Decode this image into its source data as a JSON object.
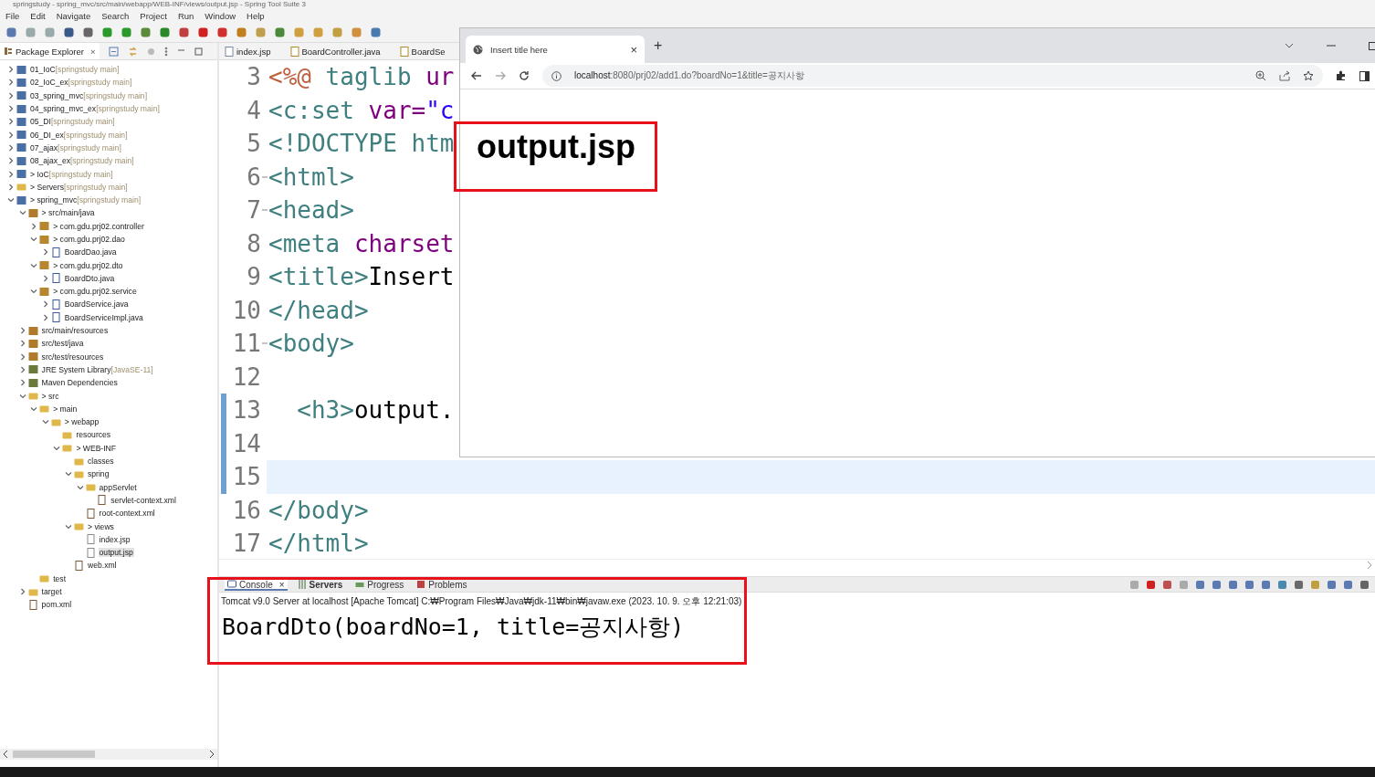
{
  "window": {
    "title": "springstudy - spring_mvc/src/main/webapp/WEB-INF/views/output.jsp - Spring Tool Suite 3"
  },
  "menu": [
    "File",
    "Edit",
    "Navigate",
    "Search",
    "Project",
    "Run",
    "Window",
    "Help"
  ],
  "explorer": {
    "title": "Package Explorer",
    "close": "×",
    "tree": [
      {
        "label": "01_IoC",
        "note": "[springstudy main]",
        "kind": "project",
        "expanded": false,
        "selected": false
      },
      {
        "label": "02_IoC_ex",
        "note": "[springstudy main]",
        "kind": "project",
        "expanded": false,
        "selected": false
      },
      {
        "label": "03_spring_mvc",
        "note": "[springstudy main]",
        "kind": "project",
        "expanded": false,
        "selected": false
      },
      {
        "label": "04_spring_mvc_ex",
        "note": "[springstudy main]",
        "kind": "project",
        "expanded": false,
        "selected": false
      },
      {
        "label": "05_DI",
        "note": "[springstudy main]",
        "kind": "project",
        "expanded": false,
        "selected": false
      },
      {
        "label": "06_DI_ex",
        "note": "[springstudy main]",
        "kind": "project",
        "expanded": false,
        "selected": false
      },
      {
        "label": "07_ajax",
        "note": "[springstudy main]",
        "kind": "project",
        "expanded": false,
        "selected": false
      },
      {
        "label": "08_ajax_ex",
        "note": "[springstudy main]",
        "kind": "project",
        "expanded": false,
        "selected": false
      },
      {
        "label": "> IoC",
        "note": "[springstudy main]",
        "kind": "project",
        "expanded": false,
        "selected": false
      },
      {
        "label": "> Servers",
        "note": "[springstudy main]",
        "kind": "folder",
        "expanded": false,
        "selected": false
      },
      {
        "label": "> spring_mvc",
        "note": "[springstudy main]",
        "kind": "project",
        "expanded": true,
        "selected": false,
        "children": [
          {
            "label": "> src/main/java",
            "kind": "source",
            "expanded": true,
            "selected": false,
            "children": [
              {
                "label": "> com.gdu.prj02.controller",
                "kind": "package",
                "expanded": false,
                "selected": false
              },
              {
                "label": "> com.gdu.prj02.dao",
                "kind": "package",
                "expanded": true,
                "selected": false,
                "children": [
                  {
                    "label": "BoardDao.java",
                    "kind": "java",
                    "expanded": false,
                    "selected": false
                  }
                ]
              },
              {
                "label": "> com.gdu.prj02.dto",
                "kind": "package",
                "expanded": true,
                "selected": false,
                "children": [
                  {
                    "label": "BoardDto.java",
                    "kind": "java",
                    "expanded": false,
                    "selected": false
                  }
                ]
              },
              {
                "label": "> com.gdu.prj02.service",
                "kind": "package",
                "expanded": true,
                "selected": false,
                "children": [
                  {
                    "label": "BoardService.java",
                    "kind": "java",
                    "expanded": false,
                    "selected": false
                  },
                  {
                    "label": "BoardServiceImpl.java",
                    "kind": "java",
                    "expanded": false,
                    "selected": false
                  }
                ]
              }
            ]
          },
          {
            "label": "src/main/resources",
            "kind": "source",
            "expanded": false,
            "selected": false
          },
          {
            "label": "src/test/java",
            "kind": "source",
            "expanded": false,
            "selected": false
          },
          {
            "label": "src/test/resources",
            "kind": "source",
            "expanded": false,
            "selected": false
          },
          {
            "label": "JRE System Library",
            "note": "[JavaSE-11]",
            "kind": "library",
            "expanded": false,
            "selected": false
          },
          {
            "label": "Maven Dependencies",
            "kind": "library",
            "expanded": false,
            "selected": false
          },
          {
            "label": "> src",
            "kind": "folder",
            "expanded": true,
            "selected": false,
            "children": [
              {
                "label": "> main",
                "kind": "folder",
                "expanded": true,
                "selected": false,
                "children": [
                  {
                    "label": "> webapp",
                    "kind": "folder",
                    "expanded": true,
                    "selected": false,
                    "children": [
                      {
                        "label": "resources",
                        "kind": "folder",
                        "selected": false
                      },
                      {
                        "label": "> WEB-INF",
                        "kind": "folder",
                        "expanded": true,
                        "selected": false,
                        "children": [
                          {
                            "label": "classes",
                            "kind": "folder",
                            "selected": false
                          },
                          {
                            "label": "spring",
                            "kind": "folder",
                            "expanded": true,
                            "selected": false,
                            "children": [
                              {
                                "label": "appServlet",
                                "kind": "folder",
                                "expanded": true,
                                "selected": false,
                                "children": [
                                  {
                                    "label": "servlet-context.xml",
                                    "kind": "xml",
                                    "selected": false
                                  }
                                ]
                              },
                              {
                                "label": "root-context.xml",
                                "kind": "xml",
                                "selected": false
                              }
                            ]
                          },
                          {
                            "label": "> views",
                            "kind": "folder",
                            "expanded": true,
                            "selected": false,
                            "children": [
                              {
                                "label": "index.jsp",
                                "kind": "file",
                                "selected": false
                              },
                              {
                                "label": "output.jsp",
                                "kind": "file",
                                "selected": true
                              }
                            ]
                          },
                          {
                            "label": "web.xml",
                            "kind": "xml",
                            "selected": false
                          }
                        ]
                      }
                    ]
                  }
                ]
              },
              {
                "label": "test",
                "kind": "folder",
                "selected": false
              }
            ]
          },
          {
            "label": "target",
            "kind": "folder",
            "expanded": false,
            "selected": false
          },
          {
            "label": "pom.xml",
            "kind": "xml",
            "selected": false
          }
        ]
      }
    ]
  },
  "editor": {
    "tabs": [
      {
        "label": "index.jsp",
        "kind": "file",
        "selected": false
      },
      {
        "label": "BoardController.java",
        "kind": "java",
        "selected": false
      },
      {
        "label": "BoardSe",
        "kind": "java",
        "selected": false
      }
    ],
    "lines": [
      {
        "no": "3",
        "fold": false,
        "changed": false,
        "current": false,
        "tokens": [
          {
            "t": "<%@",
            "color": "#bf5f3f"
          },
          {
            "t": " taglib ",
            "color": "#3f7f7f"
          },
          {
            "t": "ur",
            "color": "#7f007f"
          }
        ]
      },
      {
        "no": "4",
        "fold": false,
        "changed": false,
        "current": false,
        "tokens": [
          {
            "t": "<c:set",
            "color": "#3f7f7f"
          },
          {
            "t": " var=",
            "color": "#7f007f"
          },
          {
            "t": "\"c",
            "color": "#2a00ff"
          }
        ]
      },
      {
        "no": "5",
        "fold": false,
        "changed": false,
        "current": false,
        "tokens": [
          {
            "t": "<!DOCTYPE",
            "color": "#3f7f7f"
          },
          {
            "t": " htm",
            "color": "#3f7f7f"
          }
        ]
      },
      {
        "no": "6",
        "fold": true,
        "changed": false,
        "current": false,
        "tokens": [
          {
            "t": "<html>",
            "color": "#3f7f7f"
          }
        ]
      },
      {
        "no": "7",
        "fold": true,
        "changed": false,
        "current": false,
        "tokens": [
          {
            "t": "<head>",
            "color": "#3f7f7f"
          }
        ]
      },
      {
        "no": "8",
        "fold": false,
        "changed": false,
        "current": false,
        "tokens": [
          {
            "t": "<meta",
            "color": "#3f7f7f"
          },
          {
            "t": " charset",
            "color": "#7f007f"
          }
        ]
      },
      {
        "no": "9",
        "fold": false,
        "changed": false,
        "current": false,
        "tokens": [
          {
            "t": "<title>",
            "color": "#3f7f7f"
          },
          {
            "t": "Insert",
            "color": "#000000"
          }
        ]
      },
      {
        "no": "10",
        "fold": false,
        "changed": false,
        "current": false,
        "tokens": [
          {
            "t": "</head>",
            "color": "#3f7f7f"
          }
        ]
      },
      {
        "no": "11",
        "fold": true,
        "changed": false,
        "current": false,
        "tokens": [
          {
            "t": "<body>",
            "color": "#3f7f7f"
          }
        ]
      },
      {
        "no": "12",
        "fold": false,
        "changed": false,
        "current": false
      },
      {
        "no": "13",
        "fold": false,
        "changed": true,
        "current": false,
        "tokens": [
          {
            "t": "  <h3>",
            "color": "#3f7f7f"
          },
          {
            "t": "output.",
            "color": "#000000"
          }
        ]
      },
      {
        "no": "14",
        "fold": false,
        "changed": true,
        "current": false
      },
      {
        "no": "15",
        "fold": false,
        "changed": true,
        "current": true
      },
      {
        "no": "16",
        "fold": false,
        "changed": false,
        "current": false,
        "tokens": [
          {
            "t": "</body>",
            "color": "#3f7f7f"
          }
        ]
      },
      {
        "no": "17",
        "fold": false,
        "changed": false,
        "current": false,
        "tokens": [
          {
            "t": "</html>",
            "color": "#3f7f7f"
          }
        ]
      }
    ]
  },
  "browser": {
    "tab": {
      "title": "Insert title here",
      "close": "×"
    },
    "new_tab": "+",
    "address": {
      "host": "localhost",
      "rest": ":8080/prj02/add1.do?boardNo=1&title=공지사항"
    },
    "heading": "output.jsp"
  },
  "console": {
    "tabs": [
      {
        "label": "Console",
        "kind": "console",
        "selected": true,
        "updated": false,
        "close": "×"
      },
      {
        "label": "Servers",
        "kind": "servers",
        "selected": false,
        "updated": true
      },
      {
        "label": "Progress",
        "kind": "progress",
        "selected": false,
        "updated": false
      },
      {
        "label": "Problems",
        "kind": "problems",
        "selected": false,
        "updated": false
      }
    ],
    "description": "Tomcat v9.0 Server at localhost [Apache Tomcat] C:₩Program Files₩Java₩jdk-11₩bin₩javaw.exe  (2023. 10. 9. 오후 12:21:03)",
    "output": "BoardDto(boardNo=1, title=공지사항)"
  }
}
